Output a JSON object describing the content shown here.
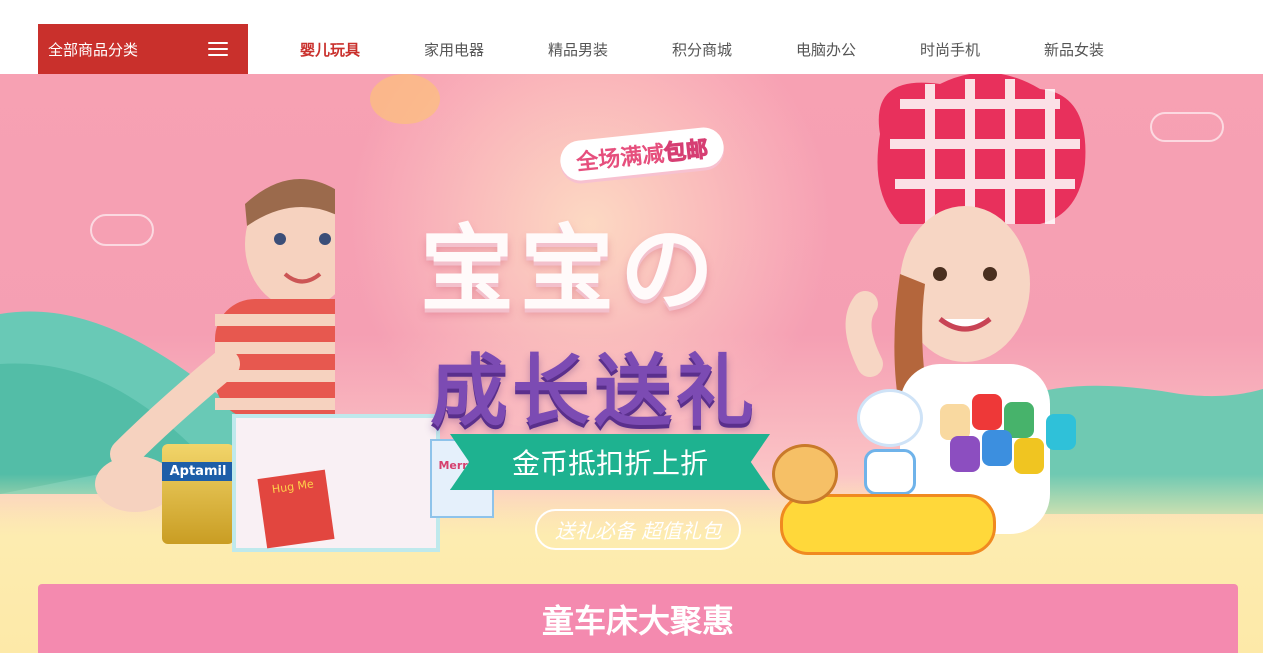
{
  "category_button": {
    "label": "全部商品分类"
  },
  "nav": {
    "items": [
      {
        "label": "婴儿玩具",
        "active": true
      },
      {
        "label": "家用电器",
        "active": false
      },
      {
        "label": "精品男装",
        "active": false
      },
      {
        "label": "积分商城",
        "active": false
      },
      {
        "label": "电脑办公",
        "active": false
      },
      {
        "label": "时尚手机",
        "active": false
      },
      {
        "label": "新品女装",
        "active": false
      }
    ]
  },
  "banner": {
    "tag_part1": "全场满减",
    "tag_part2": "包邮",
    "headline1": "宝宝の",
    "headline2": "成长送礼",
    "ribbon": "金币抵扣折上折",
    "bubble": "送礼必备 超值礼包",
    "product_label": "Aptamil",
    "book_label": "Hug Me",
    "diaper_label": "Merries"
  },
  "promo": {
    "title": "童车床大聚惠"
  },
  "colors": {
    "accent": "#c9302c",
    "promo_bg": "#f48aaf",
    "ribbon": "#1eb290",
    "headline_purple": "#7c4bb3"
  },
  "icons": {
    "menu": "hamburger-icon"
  }
}
